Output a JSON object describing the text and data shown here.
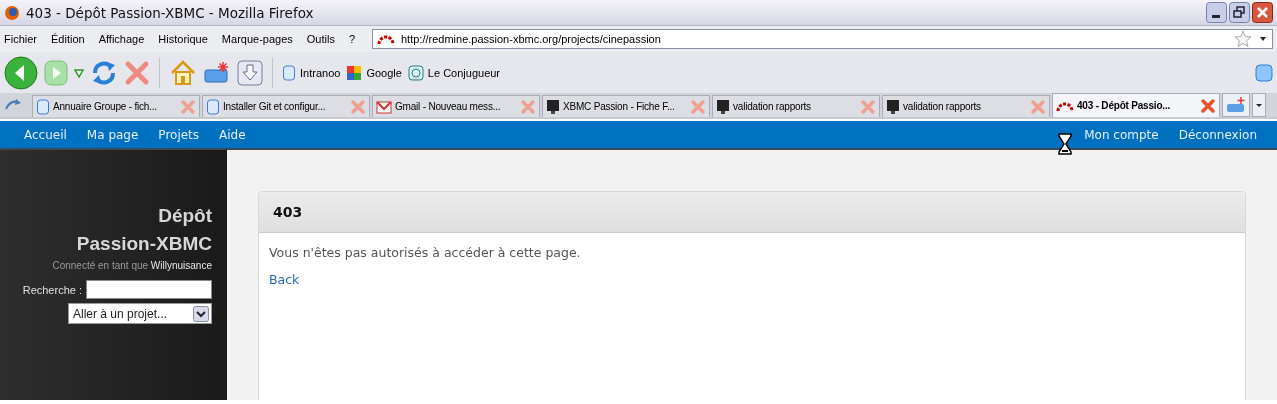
{
  "window": {
    "title": "403 - Dépôt Passion-XBMC - Mozilla Firefox"
  },
  "menu": [
    "Fichier",
    "Édition",
    "Affichage",
    "Historique",
    "Marque-pages",
    "Outils",
    "?"
  ],
  "address": {
    "url": "http://redmine.passion-xbmc.org/projects/cinepassion"
  },
  "bookmarks": [
    {
      "label": "Intranoo",
      "kind": "page"
    },
    {
      "label": "Google",
      "kind": "google"
    },
    {
      "label": "Le Conjugueur",
      "kind": "conjugueur"
    }
  ],
  "tabs": [
    {
      "label": "Annuaire Groupe - fich...",
      "kind": "page",
      "selected": false
    },
    {
      "label": "Installer Git et configur...",
      "kind": "page",
      "selected": false
    },
    {
      "label": "Gmail - Nouveau mess...",
      "kind": "gmail",
      "selected": false
    },
    {
      "label": "XBMC Passion - Fiche F...",
      "kind": "monitor",
      "selected": false
    },
    {
      "label": "validation rapports",
      "kind": "monitor",
      "selected": false
    },
    {
      "label": "validation rapports",
      "kind": "monitor",
      "selected": false
    },
    {
      "label": "403 - Dépôt Passio...",
      "kind": "redmine",
      "selected": true
    }
  ],
  "nav": {
    "left": [
      "Accueil",
      "Ma page",
      "Projets",
      "Aide"
    ],
    "right": [
      "Mon compte",
      "Déconnexion"
    ]
  },
  "sidebar": {
    "title": [
      "Dépôt",
      "Passion-XBMC"
    ],
    "logged_in": "Connecté en tant que **Willynuisance**",
    "search_label": "Recherche :",
    "project_select": "Aller à un projet..."
  },
  "panel": {
    "title": "403",
    "message": "Vous n'êtes pas autorisés à accéder à cette page.",
    "link": "Back"
  }
}
